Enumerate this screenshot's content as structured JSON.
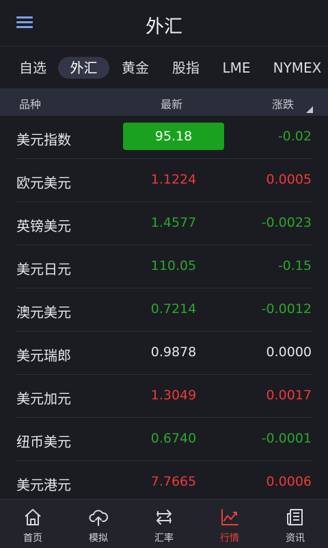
{
  "header": {
    "title": "外汇",
    "menu_icon": "hamburger-menu-icon"
  },
  "tabs": [
    {
      "label": "自选",
      "active": false
    },
    {
      "label": "外汇",
      "active": true
    },
    {
      "label": "黄金",
      "active": false
    },
    {
      "label": "股指",
      "active": false
    },
    {
      "label": "LME",
      "active": false
    },
    {
      "label": "NYMEX",
      "active": false
    }
  ],
  "columns": {
    "name": "品种",
    "latest": "最新",
    "change": "涨跌"
  },
  "rows": [
    {
      "name": "美元指数",
      "latest": "95.18",
      "change": "-0.02",
      "trend": "down",
      "highlight": true
    },
    {
      "name": "欧元美元",
      "latest": "1.1224",
      "change": "0.0005",
      "trend": "up"
    },
    {
      "name": "英镑美元",
      "latest": "1.4577",
      "change": "-0.0023",
      "trend": "down"
    },
    {
      "name": "美元日元",
      "latest": "110.05",
      "change": "-0.15",
      "trend": "down"
    },
    {
      "name": "澳元美元",
      "latest": "0.7214",
      "change": "-0.0012",
      "trend": "down"
    },
    {
      "name": "美元瑞郎",
      "latest": "0.9878",
      "change": "0.0000",
      "trend": "flat"
    },
    {
      "name": "美元加元",
      "latest": "1.3049",
      "change": "0.0017",
      "trend": "up"
    },
    {
      "name": "纽币美元",
      "latest": "0.6740",
      "change": "-0.0001",
      "trend": "down"
    },
    {
      "name": "美元港元",
      "latest": "7.7665",
      "change": "0.0006",
      "trend": "up"
    }
  ],
  "tabbar": [
    {
      "label": "首页",
      "icon": "home-icon",
      "active": false
    },
    {
      "label": "模拟",
      "icon": "cloud-upload-icon",
      "active": false
    },
    {
      "label": "汇率",
      "icon": "exchange-icon",
      "active": false
    },
    {
      "label": "行情",
      "icon": "trend-chart-icon",
      "active": true
    },
    {
      "label": "资讯",
      "icon": "news-icon",
      "active": false
    }
  ],
  "colors": {
    "up": "#f0383b",
    "down": "#2aa82a",
    "highlight": "#1aa11d",
    "active_tab": "#e9413c"
  }
}
